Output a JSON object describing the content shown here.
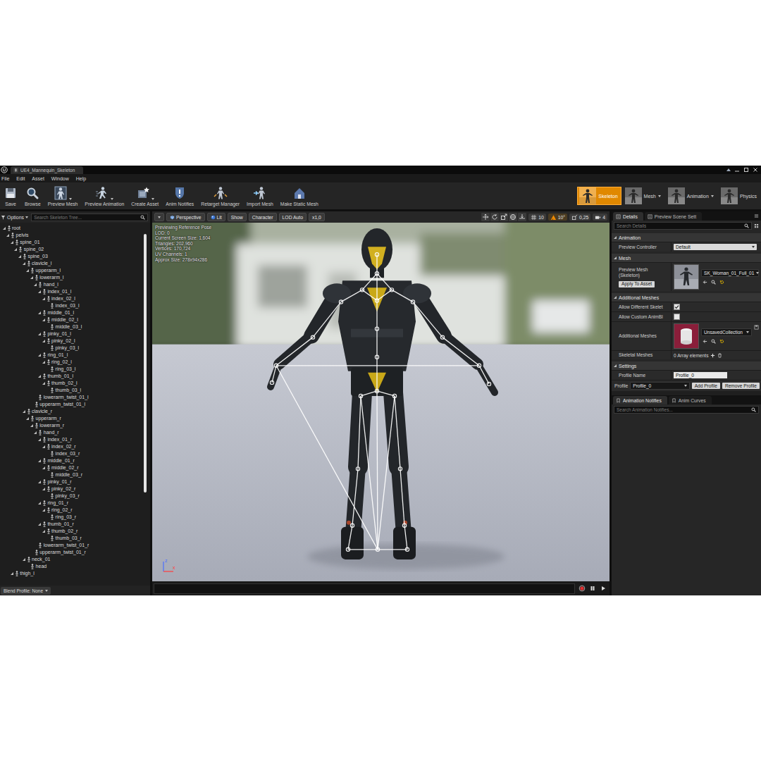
{
  "window": {
    "title": "UE4_Mannequin_Skeleton"
  },
  "menu": [
    "File",
    "Edit",
    "Asset",
    "Window",
    "Help"
  ],
  "toolbar": [
    {
      "label": "Save",
      "dropdown": false
    },
    {
      "label": "Browse",
      "dropdown": false
    },
    {
      "label": "Preview Mesh",
      "dropdown": true
    },
    {
      "label": "Preview Animation",
      "dropdown": true
    },
    {
      "label": "Create Asset",
      "dropdown": true
    },
    {
      "label": "Anim Notifies",
      "dropdown": false
    },
    {
      "label": "Retarget Manager",
      "dropdown": false
    },
    {
      "label": "Import Mesh",
      "dropdown": false
    },
    {
      "label": "Make Static Mesh",
      "dropdown": false
    }
  ],
  "modes": [
    {
      "label": "Skeleton",
      "selected": true,
      "dropdown": false
    },
    {
      "label": "Mesh",
      "selected": false,
      "dropdown": true
    },
    {
      "label": "Animation",
      "selected": false,
      "dropdown": true
    },
    {
      "label": "Physics",
      "selected": false,
      "dropdown": false
    }
  ],
  "skeleton_tree": {
    "options": "Options",
    "search_placeholder": "Search Skeleton Tree...",
    "footer": "Blend Profile: None",
    "bones": [
      {
        "name": "root",
        "expanded": true,
        "children": [
          {
            "name": "pelvis",
            "expanded": true,
            "children": [
              {
                "name": "spine_01",
                "expanded": true,
                "children": [
                  {
                    "name": "spine_02",
                    "expanded": true,
                    "children": [
                      {
                        "name": "spine_03",
                        "expanded": true,
                        "children": [
                          {
                            "name": "clavicle_l",
                            "expanded": true,
                            "children": [
                              {
                                "name": "upperarm_l",
                                "expanded": true,
                                "children": [
                                  {
                                    "name": "lowerarm_l",
                                    "expanded": true,
                                    "children": [
                                      {
                                        "name": "hand_l",
                                        "expanded": true,
                                        "children": [
                                          {
                                            "name": "index_01_l",
                                            "expanded": true,
                                            "children": [
                                              {
                                                "name": "index_02_l",
                                                "expanded": true,
                                                "children": [
                                                  {
                                                    "name": "index_03_l",
                                                    "expanded": false,
                                                    "children": []
                                                  }
                                                ]
                                              }
                                            ]
                                          },
                                          {
                                            "name": "middle_01_l",
                                            "expanded": true,
                                            "children": [
                                              {
                                                "name": "middle_02_l",
                                                "expanded": true,
                                                "children": [
                                                  {
                                                    "name": "middle_03_l",
                                                    "expanded": false,
                                                    "children": []
                                                  }
                                                ]
                                              }
                                            ]
                                          },
                                          {
                                            "name": "pinky_01_l",
                                            "expanded": true,
                                            "children": [
                                              {
                                                "name": "pinky_02_l",
                                                "expanded": true,
                                                "children": [
                                                  {
                                                    "name": "pinky_03_l",
                                                    "expanded": false,
                                                    "children": []
                                                  }
                                                ]
                                              }
                                            ]
                                          },
                                          {
                                            "name": "ring_01_l",
                                            "expanded": true,
                                            "children": [
                                              {
                                                "name": "ring_02_l",
                                                "expanded": true,
                                                "children": [
                                                  {
                                                    "name": "ring_03_l",
                                                    "expanded": false,
                                                    "children": []
                                                  }
                                                ]
                                              }
                                            ]
                                          },
                                          {
                                            "name": "thumb_01_l",
                                            "expanded": true,
                                            "children": [
                                              {
                                                "name": "thumb_02_l",
                                                "expanded": true,
                                                "children": [
                                                  {
                                                    "name": "thumb_03_l",
                                                    "expanded": false,
                                                    "children": []
                                                  }
                                                ]
                                              }
                                            ]
                                          }
                                        ]
                                      },
                                      {
                                        "name": "lowerarm_twist_01_l",
                                        "expanded": false,
                                        "children": []
                                      }
                                    ]
                                  },
                                  {
                                    "name": "upperarm_twist_01_l",
                                    "expanded": false,
                                    "children": []
                                  }
                                ]
                              }
                            ]
                          },
                          {
                            "name": "clavicle_r",
                            "expanded": true,
                            "children": [
                              {
                                "name": "upperarm_r",
                                "expanded": true,
                                "children": [
                                  {
                                    "name": "lowerarm_r",
                                    "expanded": true,
                                    "children": [
                                      {
                                        "name": "hand_r",
                                        "expanded": true,
                                        "children": [
                                          {
                                            "name": "index_01_r",
                                            "expanded": true,
                                            "children": [
                                              {
                                                "name": "index_02_r",
                                                "expanded": true,
                                                "children": [
                                                  {
                                                    "name": "index_03_r",
                                                    "expanded": false,
                                                    "children": []
                                                  }
                                                ]
                                              }
                                            ]
                                          },
                                          {
                                            "name": "middle_01_r",
                                            "expanded": true,
                                            "children": [
                                              {
                                                "name": "middle_02_r",
                                                "expanded": true,
                                                "children": [
                                                  {
                                                    "name": "middle_03_r",
                                                    "expanded": false,
                                                    "children": []
                                                  }
                                                ]
                                              }
                                            ]
                                          },
                                          {
                                            "name": "pinky_01_r",
                                            "expanded": true,
                                            "children": [
                                              {
                                                "name": "pinky_02_r",
                                                "expanded": true,
                                                "children": [
                                                  {
                                                    "name": "pinky_03_r",
                                                    "expanded": false,
                                                    "children": []
                                                  }
                                                ]
                                              }
                                            ]
                                          },
                                          {
                                            "name": "ring_01_r",
                                            "expanded": true,
                                            "children": [
                                              {
                                                "name": "ring_02_r",
                                                "expanded": true,
                                                "children": [
                                                  {
                                                    "name": "ring_03_r",
                                                    "expanded": false,
                                                    "children": []
                                                  }
                                                ]
                                              }
                                            ]
                                          },
                                          {
                                            "name": "thumb_01_r",
                                            "expanded": true,
                                            "children": [
                                              {
                                                "name": "thumb_02_r",
                                                "expanded": true,
                                                "children": [
                                                  {
                                                    "name": "thumb_03_r",
                                                    "expanded": false,
                                                    "children": []
                                                  }
                                                ]
                                              }
                                            ]
                                          }
                                        ]
                                      },
                                      {
                                        "name": "lowerarm_twist_01_r",
                                        "expanded": false,
                                        "children": []
                                      }
                                    ]
                                  },
                                  {
                                    "name": "upperarm_twist_01_r",
                                    "expanded": false,
                                    "children": []
                                  }
                                ]
                              }
                            ]
                          },
                          {
                            "name": "neck_01",
                            "expanded": true,
                            "children": [
                              {
                                "name": "head",
                                "expanded": false,
                                "children": []
                              }
                            ]
                          }
                        ]
                      }
                    ]
                  }
                ]
              },
              {
                "name": "thigh_l",
                "expanded": true,
                "children": []
              }
            ]
          }
        ]
      }
    ]
  },
  "viewport": {
    "buttons": [
      "Perspective",
      "Lit",
      "Show",
      "Character",
      "LOD Auto",
      "x1,0"
    ],
    "snaps": [
      {
        "value": "10",
        "active": false
      },
      {
        "value": "10°",
        "active": true
      },
      {
        "value": "0,25",
        "active": false
      },
      {
        "value": "4",
        "active": false
      }
    ],
    "info": [
      "Previewing Reference Pose",
      "LOD: 0",
      "Current Screen Size: 1,604",
      "Triangles: 202,960",
      "Vertices: 170,724",
      "UV Channels: 1",
      "Approx Size: 278x94x286"
    ],
    "axes": [
      "z",
      "x"
    ]
  },
  "details": {
    "tabs": [
      {
        "label": "Details",
        "selected": true
      },
      {
        "label": "Preview Scene Sett",
        "selected": false
      }
    ],
    "search_placeholder": "Search Details",
    "sections": [
      {
        "title": "Animation",
        "expanded": true,
        "rows": [
          {
            "kind": "dropdown",
            "label": "Preview Controller",
            "value": "Default"
          }
        ]
      },
      {
        "title": "Mesh",
        "expanded": true,
        "rows": [
          {
            "kind": "mesh",
            "label": "Preview Mesh (Skeleton)",
            "value": "SK_Woman_01_Full_01",
            "button": "Apply To Asset"
          }
        ]
      },
      {
        "title": "Additional Meshes",
        "expanded": true,
        "rows": [
          {
            "kind": "checkbox",
            "label": "Allow Different Skelet",
            "checked": true
          },
          {
            "kind": "checkbox",
            "label": "Allow Custom AnimBl",
            "checked": false
          },
          {
            "kind": "collection",
            "label": "Additional Meshes",
            "value": "UnsavedCollection"
          },
          {
            "kind": "array",
            "label": "Skeletal Meshes",
            "value": "0 Array elements"
          }
        ]
      },
      {
        "title": "Settings",
        "expanded": true,
        "rows": [
          {
            "kind": "text",
            "label": "Profile Name",
            "value": "Profile_0"
          },
          {
            "kind": "profile",
            "label": "Profile",
            "value": "Profile_0",
            "buttons": [
              "Add Profile",
              "Remove Profile"
            ]
          }
        ]
      }
    ]
  },
  "notifies": {
    "tabs": [
      {
        "label": "Animation Notifies",
        "selected": true
      },
      {
        "label": "Anim Curves",
        "selected": false
      }
    ],
    "search_placeholder": "Search Animation Notifies..."
  }
}
